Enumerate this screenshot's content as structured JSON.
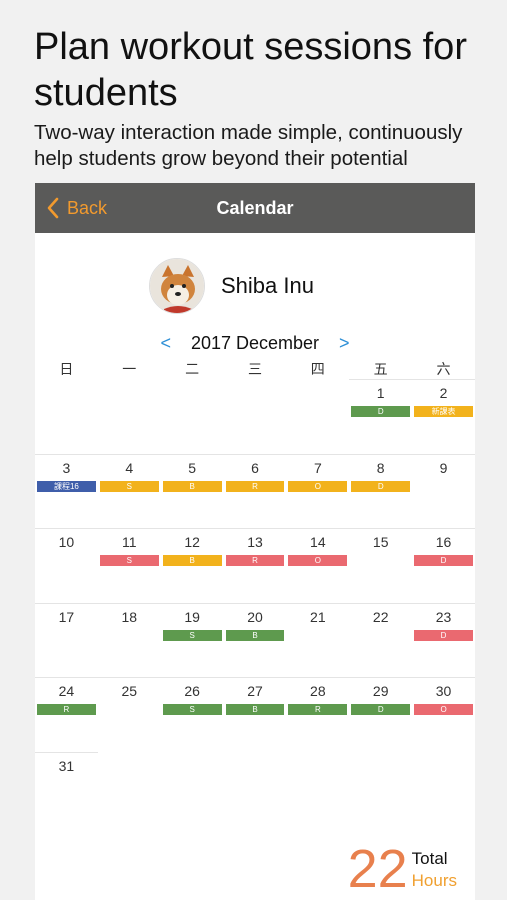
{
  "promo": {
    "headline": "Plan workout sessions for students",
    "subline": "Two-way interaction made simple, continuously help students grow beyond their potential"
  },
  "navbar": {
    "back_label": "Back",
    "title": "Calendar",
    "back_icon": "chevron-left-icon"
  },
  "student": {
    "name": "Shiba Inu",
    "avatar": "shiba-inu-avatar"
  },
  "calendar": {
    "month_label": "2017 December",
    "prev_label": "<",
    "next_label": ">",
    "weekdays": [
      "日",
      "一",
      "二",
      "三",
      "四",
      "五",
      "六"
    ],
    "weeks": [
      [
        null,
        null,
        null,
        null,
        null,
        {
          "day": "1",
          "tag": "D",
          "color": "green"
        },
        {
          "day": "2",
          "tag": "新課表",
          "color": "yellow"
        }
      ],
      [
        {
          "day": "3",
          "tag": "課程16",
          "color": "blue"
        },
        {
          "day": "4",
          "tag": "S",
          "color": "yellow"
        },
        {
          "day": "5",
          "tag": "B",
          "color": "yellow"
        },
        {
          "day": "6",
          "tag": "R",
          "color": "yellow"
        },
        {
          "day": "7",
          "tag": "O",
          "color": "yellow"
        },
        {
          "day": "8",
          "tag": "D",
          "color": "yellow"
        },
        {
          "day": "9"
        }
      ],
      [
        {
          "day": "10"
        },
        {
          "day": "11",
          "tag": "S",
          "color": "red"
        },
        {
          "day": "12",
          "tag": "B",
          "color": "yellow"
        },
        {
          "day": "13",
          "tag": "R",
          "color": "red"
        },
        {
          "day": "14",
          "tag": "O",
          "color": "red"
        },
        {
          "day": "15"
        },
        {
          "day": "16",
          "tag": "D",
          "color": "red"
        }
      ],
      [
        {
          "day": "17"
        },
        {
          "day": "18"
        },
        {
          "day": "19",
          "tag": "S",
          "color": "green"
        },
        {
          "day": "20",
          "tag": "B",
          "color": "green"
        },
        {
          "day": "21"
        },
        {
          "day": "22"
        },
        {
          "day": "23",
          "tag": "D",
          "color": "red"
        }
      ],
      [
        {
          "day": "24",
          "tag": "R",
          "color": "green"
        },
        {
          "day": "25"
        },
        {
          "day": "26",
          "tag": "S",
          "color": "green"
        },
        {
          "day": "27",
          "tag": "B",
          "color": "green"
        },
        {
          "day": "28",
          "tag": "R",
          "color": "green"
        },
        {
          "day": "29",
          "tag": "D",
          "color": "green"
        },
        {
          "day": "30",
          "tag": "O",
          "color": "red"
        }
      ],
      [
        {
          "day": "31"
        },
        null,
        null,
        null,
        null,
        null,
        null
      ]
    ]
  },
  "total": {
    "value": "22",
    "label_top": "Total",
    "label_bottom": "Hours"
  },
  "colors": {
    "green": "#5e9a4e",
    "yellow": "#f2b21c",
    "red": "#ea6970",
    "blue": "#3f5eaa",
    "accent": "#f29a2e",
    "navbar": "#5a5a59"
  }
}
